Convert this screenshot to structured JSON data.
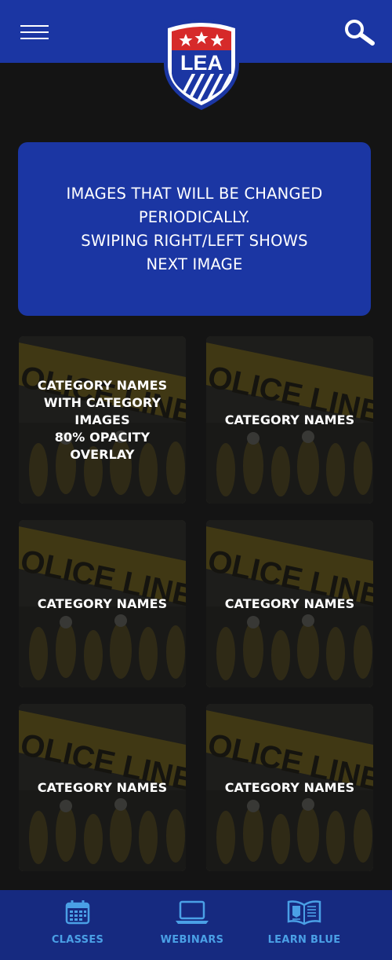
{
  "header": {
    "logo_text": "LEA",
    "menu_icon": "hamburger-menu-icon",
    "search_icon": "search-icon"
  },
  "hero": {
    "lines": [
      "IMAGES THAT WILL BE CHANGED",
      "PERIODICALLY.",
      "SWIPING RIGHT/LEFT SHOWS",
      "NEXT IMAGE"
    ]
  },
  "tiles": [
    {
      "lines": [
        "CATEGORY NAMES",
        "WITH CATEGORY",
        "IMAGES",
        "80% OPACITY",
        "OVERLAY"
      ]
    },
    {
      "lines": [
        "CATEGORY NAMES"
      ]
    },
    {
      "lines": [
        "CATEGORY NAMES"
      ]
    },
    {
      "lines": [
        "CATEGORY NAMES"
      ]
    },
    {
      "lines": [
        "CATEGORY NAMES"
      ]
    },
    {
      "lines": [
        "CATEGORY NAMES"
      ]
    }
  ],
  "tile_image_text": "OLICE LINE DO NOT C",
  "bottom_nav": [
    {
      "label": "CLASSES",
      "icon": "calendar-icon"
    },
    {
      "label": "WEBINARS",
      "icon": "laptop-icon"
    },
    {
      "label": "LEARN BLUE",
      "icon": "open-book-icon"
    }
  ],
  "colors": {
    "header": "#1b36a3",
    "background": "#141414",
    "bottom_nav": "#162a80",
    "nav_accent": "#4aa0e6",
    "logo_red": "#d62a2a"
  }
}
